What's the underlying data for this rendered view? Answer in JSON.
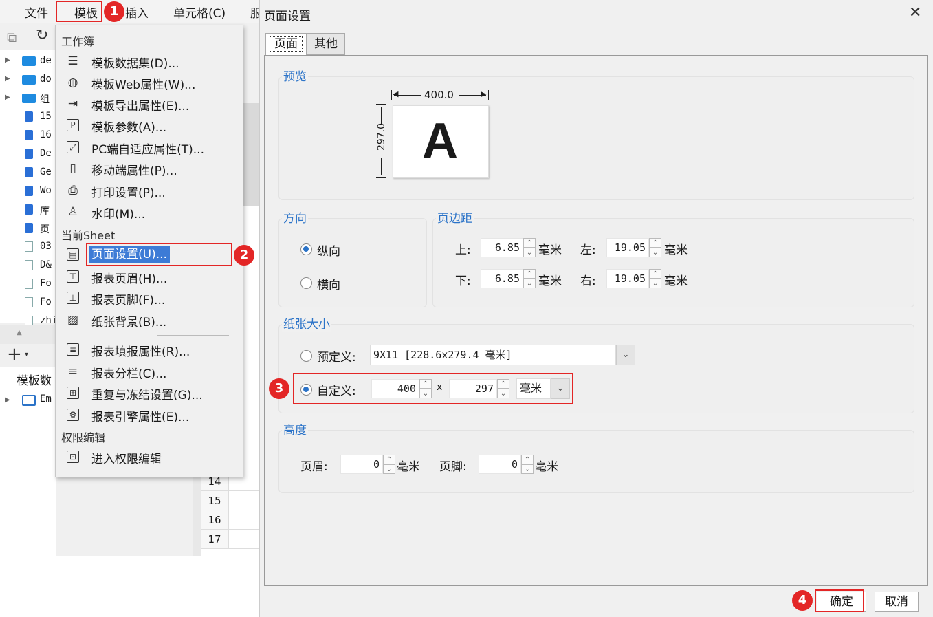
{
  "menubar": {
    "file": "文件",
    "template": "模板",
    "insert": "插入",
    "cell": "单元格(C)",
    "overflow": "服"
  },
  "tree": {
    "items": [
      {
        "label": "de",
        "kind": "folder"
      },
      {
        "label": "do",
        "kind": "folder"
      },
      {
        "label": "组",
        "kind": "folder"
      },
      {
        "label": "15",
        "kind": "report"
      },
      {
        "label": "16",
        "kind": "report"
      },
      {
        "label": "De",
        "kind": "report"
      },
      {
        "label": "Ge",
        "kind": "report"
      },
      {
        "label": "Wo",
        "kind": "report"
      },
      {
        "label": "库",
        "kind": "report"
      },
      {
        "label": "页",
        "kind": "report"
      },
      {
        "label": "03",
        "kind": "doc"
      },
      {
        "label": "D&",
        "kind": "doc"
      },
      {
        "label": "Fo",
        "kind": "doc"
      },
      {
        "label": "Fo",
        "kind": "doc"
      },
      {
        "label": "zhi",
        "kind": "doc"
      }
    ],
    "dataset_header": "模板数",
    "dataset_item": "Em"
  },
  "grid": {
    "rows": [
      "14",
      "15",
      "16",
      "17"
    ]
  },
  "menu": {
    "sec_workbook": "工作簿",
    "sec_sheet": "当前Sheet",
    "sec_perm": "权限编辑",
    "items": [
      {
        "label": "模板数据集(D)...",
        "icon": "database-icon"
      },
      {
        "label": "模板Web属性(W)...",
        "icon": "globe-icon"
      },
      {
        "label": "模板导出属性(E)...",
        "icon": "export-icon"
      },
      {
        "label": "模板参数(A)...",
        "icon": "parameter-icon"
      },
      {
        "label": "PC端自适应属性(T)...",
        "icon": "resize-icon"
      },
      {
        "label": "移动端属性(P)...",
        "icon": "mobile-icon"
      },
      {
        "label": "打印设置(P)...",
        "icon": "printer-icon"
      },
      {
        "label": "水印(M)...",
        "icon": "stamp-icon"
      },
      {
        "label": "页面设置(U)...",
        "icon": "page-icon"
      },
      {
        "label": "报表页眉(H)...",
        "icon": "header-icon"
      },
      {
        "label": "报表页脚(F)...",
        "icon": "footer-icon"
      },
      {
        "label": "纸张背景(B)...",
        "icon": "picture-icon"
      },
      {
        "label": "报表填报属性(R)...",
        "icon": "form-icon"
      },
      {
        "label": "报表分栏(C)...",
        "icon": "columns-icon"
      },
      {
        "label": "重复与冻结设置(G)...",
        "icon": "freeze-icon"
      },
      {
        "label": "报表引擎属性(E)...",
        "icon": "engine-icon"
      },
      {
        "label": "进入权限编辑",
        "icon": "permission-icon"
      }
    ]
  },
  "badges": [
    "1",
    "2",
    "3",
    "4"
  ],
  "dialog": {
    "title": "页面设置",
    "tabs": [
      "页面",
      "其他"
    ],
    "preview": {
      "title": "预览",
      "width_label": "400.0",
      "height_label": "297.0",
      "letter": "A"
    },
    "orientation": {
      "title": "方向",
      "portrait": "纵向",
      "landscape": "横向",
      "selected": "portrait"
    },
    "margins": {
      "title": "页边距",
      "top_label": "上:",
      "top": "6.85",
      "bottom_label": "下:",
      "bottom": "6.85",
      "left_label": "左:",
      "left": "19.05",
      "right_label": "右:",
      "right": "19.05",
      "unit": "毫米"
    },
    "paper": {
      "title": "纸张大小",
      "predefined_label": "预定义:",
      "predefined_value": "9X11 [228.6x279.4 毫米]",
      "custom_label": "自定义:",
      "width": "400",
      "times": "x",
      "height": "297",
      "unit": "毫米",
      "selected": "custom"
    },
    "height": {
      "title": "高度",
      "header_label": "页眉:",
      "header": "0",
      "footer_label": "页脚:",
      "footer": "0",
      "unit": "毫米"
    },
    "ok": "确定",
    "cancel": "取消"
  },
  "colors": {
    "accent": "#2b73c8",
    "highlight": "#3d7bd6",
    "callout": "#e32626"
  }
}
